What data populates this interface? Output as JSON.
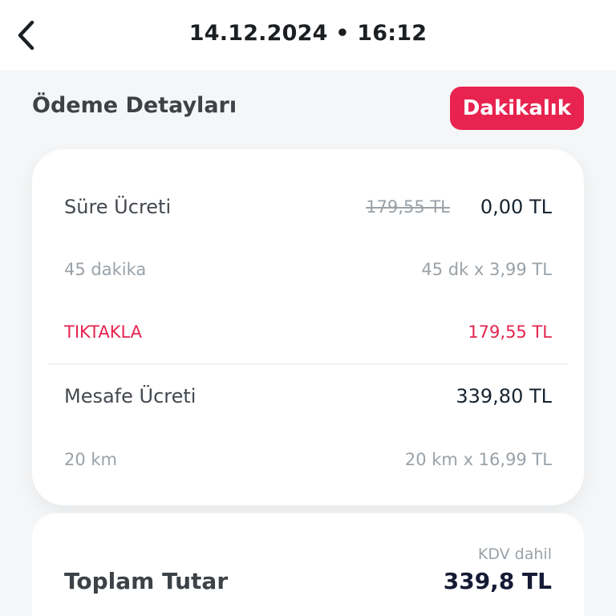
{
  "header": {
    "title": "14.12.2024 • 16:12",
    "back_icon": "chevron-left-icon"
  },
  "section": {
    "title": "Ödeme Detayları",
    "badge": "Dakikalık"
  },
  "details": {
    "duration": {
      "label": "Süre Ücreti",
      "original": "179,55 TL",
      "amount": "0,00 TL"
    },
    "duration_sub": {
      "label": "45 dakika",
      "calc": "45 dk x 3,99 TL"
    },
    "campaign": {
      "label": "TIKTAKLA",
      "amount": "179,55 TL"
    },
    "distance": {
      "label": "Mesafe Ücreti",
      "amount": "339,80 TL"
    },
    "distance_sub": {
      "label": "20 km",
      "calc": "20 km x 16,99 TL"
    }
  },
  "total": {
    "tax_note": "KDV dahil",
    "label": "Toplam Tutar",
    "amount": "339,8 TL"
  },
  "colors": {
    "accent": "#e8234f",
    "background": "#f5f6f7",
    "card": "#ffffff",
    "muted": "#9aa2a8"
  }
}
